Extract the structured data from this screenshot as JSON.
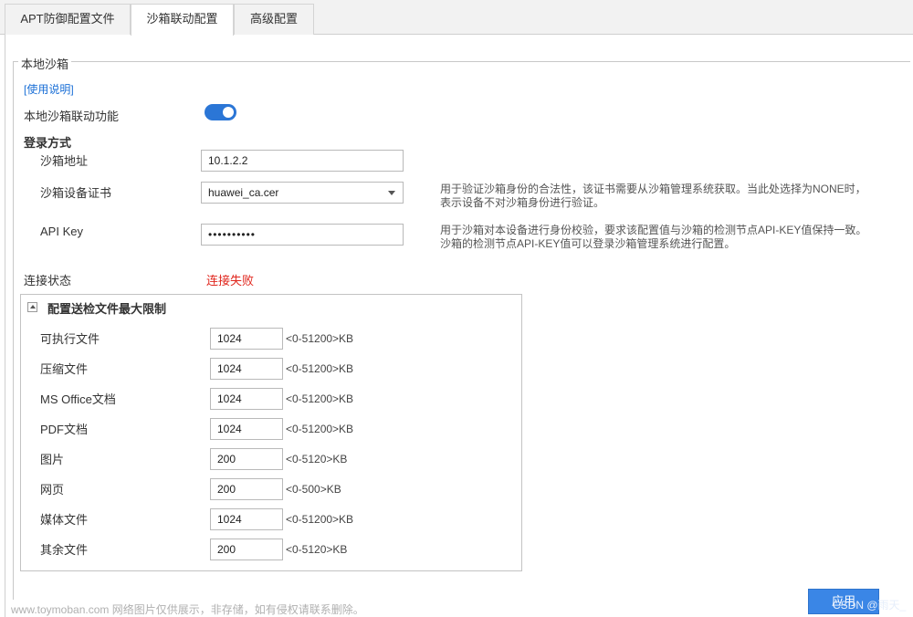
{
  "tabs": [
    {
      "label": "APT防御配置文件"
    },
    {
      "label": "沙箱联动配置"
    },
    {
      "label": "高级配置"
    }
  ],
  "section": {
    "legend": "本地沙箱",
    "usage_link": "[使用说明]",
    "linkage_label": "本地沙箱联动功能",
    "linkage_enabled": true,
    "login_title": "登录方式",
    "address_label": "沙箱地址",
    "address_value": "10.1.2.2",
    "cert_label": "沙箱设备证书",
    "cert_value": "huawei_ca.cer",
    "cert_hint": "用于验证沙箱身份的合法性，该证书需要从沙箱管理系统获取。当此处选择为NONE时，表示设备不对沙箱身份进行验证。",
    "apikey_label": "API Key",
    "apikey_value": "••••••••••",
    "apikey_hint": "用于沙箱对本设备进行身份校验，要求该配置值与沙箱的检测节点API-KEY值保持一致。沙箱的检测节点API-KEY值可以登录沙箱管理系统进行配置。",
    "status_label": "连接状态",
    "status_value": "连接失败",
    "status_color": "#e0251c"
  },
  "limits": {
    "title": "配置送检文件最大限制",
    "rows": [
      {
        "label": "可执行文件",
        "value": "1024",
        "range": "<0-51200>KB"
      },
      {
        "label": "压缩文件",
        "value": "1024",
        "range": "<0-51200>KB"
      },
      {
        "label": "MS Office文档",
        "value": "1024",
        "range": "<0-51200>KB"
      },
      {
        "label": "PDF文档",
        "value": "1024",
        "range": "<0-51200>KB"
      },
      {
        "label": "图片",
        "value": "200",
        "range": "<0-5120>KB"
      },
      {
        "label": "网页",
        "value": "200",
        "range": "<0-500>KB"
      },
      {
        "label": "媒体文件",
        "value": "1024",
        "range": "<0-51200>KB"
      },
      {
        "label": "其余文件",
        "value": "200",
        "range": "<0-5120>KB"
      }
    ]
  },
  "apply_label": "应用",
  "accent_color": "#2b76d6",
  "watermark": "www.toymoban.com 网络图片仅供展示，非存储，如有侵权请联系删除。",
  "watermark_right": "CSDN @雨天_"
}
